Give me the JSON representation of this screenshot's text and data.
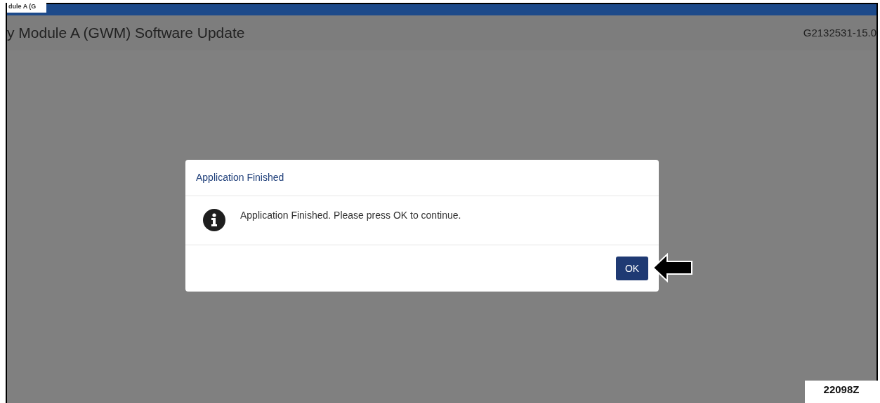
{
  "tab": {
    "label": "dule A (G"
  },
  "header": {
    "title": "y Module A (GWM) Software Update",
    "code": "G2132531-15.0"
  },
  "dialog": {
    "title": "Application Finished",
    "message": "Application Finished. Please press OK to continue.",
    "button": "OK"
  },
  "figure_label": "22098Z"
}
